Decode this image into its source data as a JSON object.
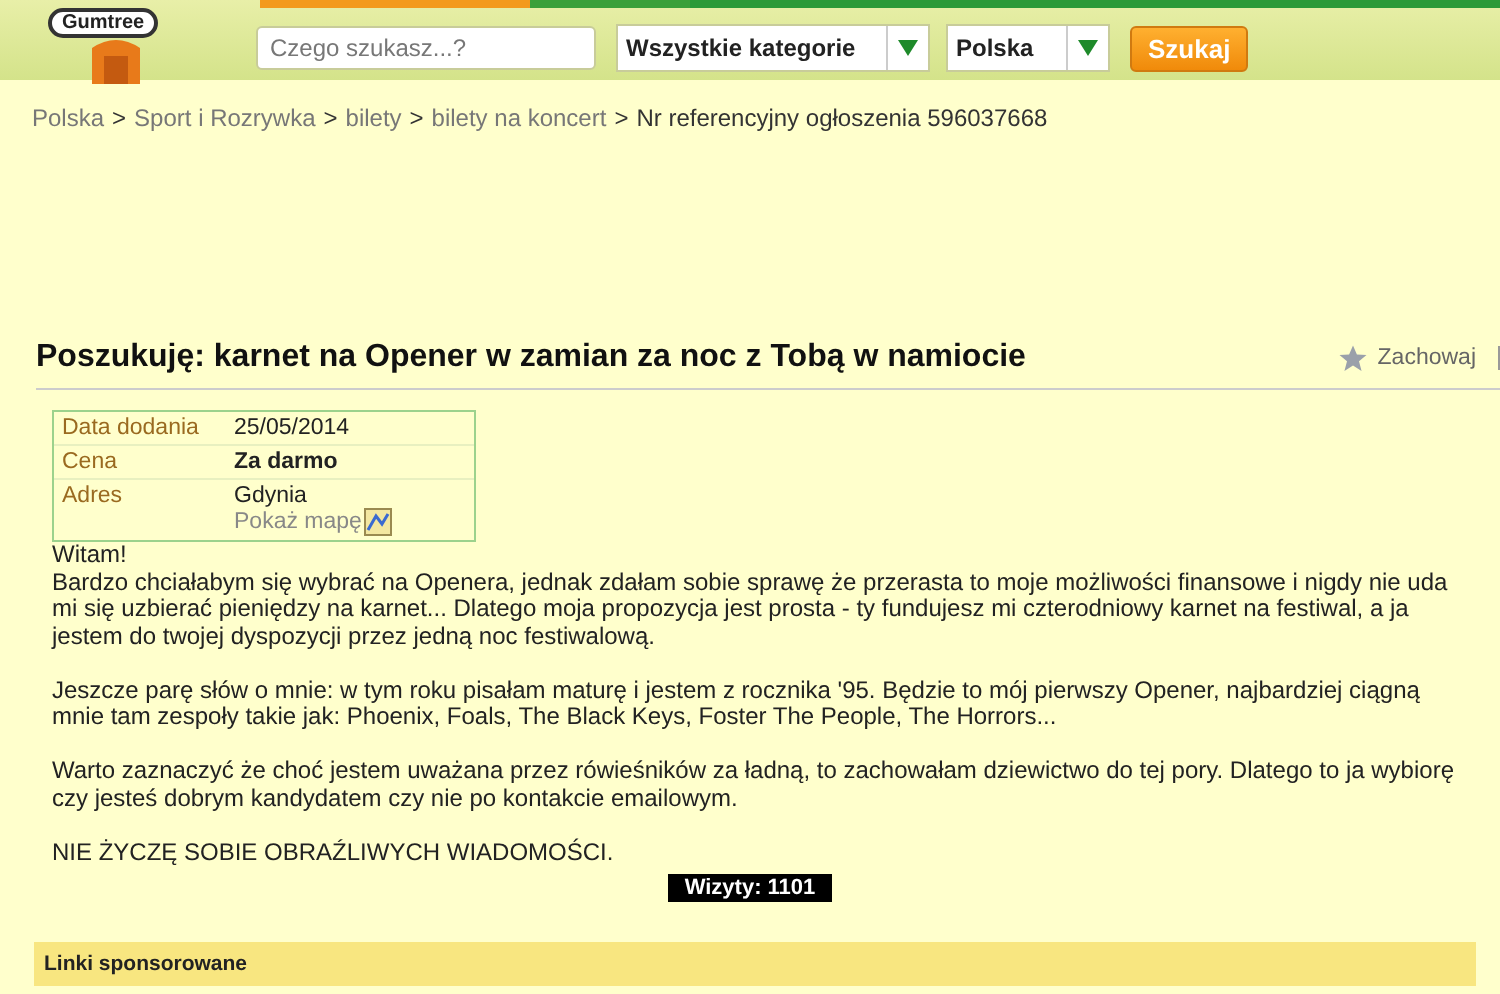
{
  "header": {
    "logo": "Gumtree",
    "search": {
      "placeholder": "Czego szukasz...?"
    },
    "category": "Wszystkie kategorie",
    "location": "Polska",
    "search_button": "Szukaj"
  },
  "breadcrumb": [
    {
      "label": "Polska",
      "link": true
    },
    {
      "label": ">",
      "link": false
    },
    {
      "label": "Sport i Rozrywka",
      "link": true
    },
    {
      "label": ">",
      "link": false
    },
    {
      "label": "bilety",
      "link": true
    },
    {
      "label": ">",
      "link": false
    },
    {
      "label": "bilety na koncert",
      "link": true
    },
    {
      "label": ">",
      "link": false
    },
    {
      "label": "Nr referencyjny ogłoszenia 596037668",
      "link": false
    }
  ],
  "ad": {
    "title": "Poszukuję: karnet na Opener w zamian za noc z Tobą w namiocie",
    "save": "Zachowaj",
    "details": [
      {
        "label": "Data dodania",
        "value": "25/05/2014",
        "bold": false
      },
      {
        "label": "Cena",
        "value": "Za darmo",
        "bold": true
      },
      {
        "label": "Adres",
        "value": "Gdynia",
        "bold": false,
        "map_link": "Pokaż mapę"
      }
    ],
    "description": [
      "Witam!\nBardzo chciałabym się wybrać na Openera, jednak zdałam sobie sprawę że przerasta to moje możliwości finansowe i nigdy nie uda mi się uzbierać pieniędzy na karnet... Dlatego moja propozycja jest prosta - ty fundujesz mi czterodniowy karnet na festiwal, a ja jestem do twojej dyspozycji przez jedną noc festiwalową.",
      "Jeszcze parę słów o mnie: w tym roku pisałam maturę i jestem z rocznika '95. Będzie to mój pierwszy Opener, najbardziej ciągną mnie tam zespoły takie jak: Phoenix, Foals, The Black Keys, Foster The People, The Horrors...",
      "Warto zaznaczyć że choć jestem uważana przez rówieśników za ładną, to zachowałam dziewictwo do tej pory. Dlatego to ja wybiorę czy jesteś dobrym kandydatem czy nie po kontakcie emailowym.",
      "NIE ŻYCZĘ SOBIE OBRAŹLIWYCH WIADOMOŚCI."
    ],
    "visits": "Wizyty: 1101"
  },
  "sponsored": "Linki sponsorowane"
}
